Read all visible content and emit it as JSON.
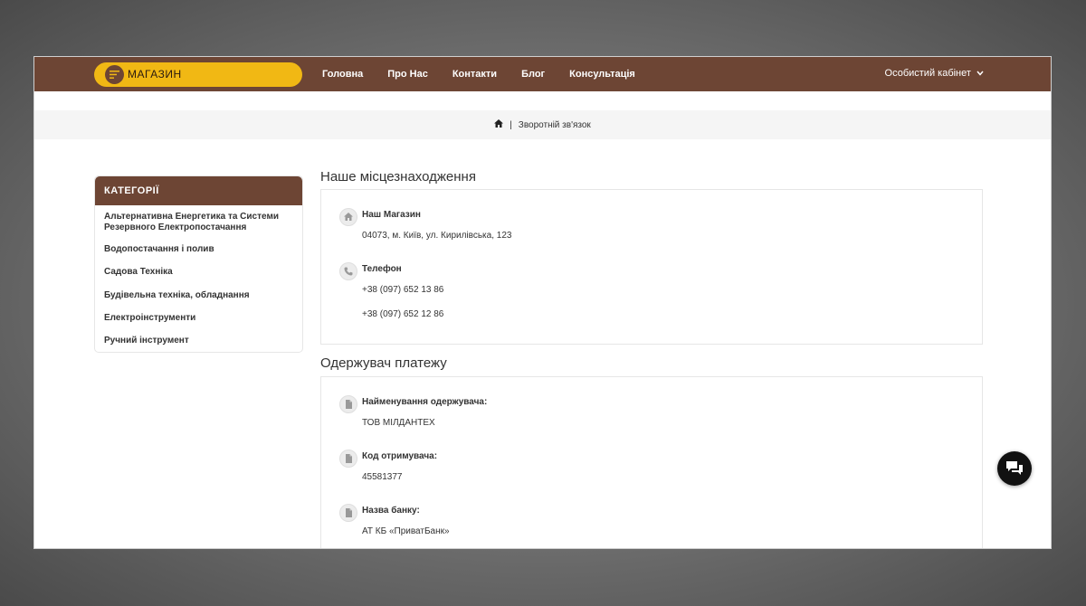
{
  "header": {
    "shop_label": "МАГАЗИН",
    "nav": [
      "Головна",
      "Про Нас",
      "Контакти",
      "Блог",
      "Консультація"
    ],
    "account_label": "Особистий кабінет"
  },
  "breadcrumb": {
    "separator": "|",
    "current": "Зворотній зв'язок"
  },
  "sidebar": {
    "title": "КАТЕГОРІЇ",
    "items": [
      "Альтернативна Енергетика та Системи Резервного Електропостачання",
      "Водопостачання і полив",
      "Садова Техніка",
      "Будівельна техніка, обладнання",
      "Електроінструменти",
      "Ручний інструмент"
    ]
  },
  "location": {
    "heading": "Наше місцезнаходження",
    "store_title": "Наш Магазин",
    "store_address": "04073, м. Київ, ул. Кирилівська, 123",
    "phone_title": "Телефон",
    "phones": [
      "+38 (097) 652 13 86",
      "+38 (097) 652 12 86"
    ]
  },
  "payment": {
    "heading": "Одержувач платежу",
    "recipient_title": "Найменування одержувача:",
    "recipient_value": "ТОВ МІЛДАНТЕХ",
    "code_title": "Код отримувача:",
    "code_value": "45581377",
    "bank_title": "Назва банку:",
    "bank_value": "АТ КБ «ПриватБанк»"
  },
  "colors": {
    "brand_brown": "#6d4534",
    "accent_yellow": "#f1b814"
  },
  "icons": [
    "menu-icon",
    "chevron-down-icon",
    "home-icon",
    "phone-icon",
    "file-icon",
    "chat-icon"
  ]
}
